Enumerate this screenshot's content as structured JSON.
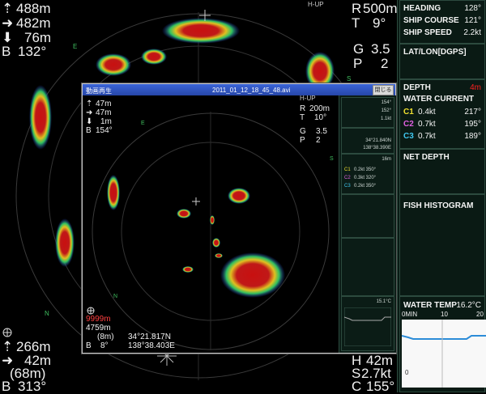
{
  "scope": {
    "top_left": {
      "arrow_up": "488m",
      "arrow_right": "482m",
      "arrow_down": "76m",
      "b": "B",
      "b_val": "132°"
    },
    "top_right": {
      "r": "R",
      "r_val": "500m",
      "t": "T",
      "t_val": "9°",
      "g": "G",
      "g_val": "3.5",
      "p": "P",
      "p_val": "2",
      "mode": "H-UP"
    },
    "bottom_left": {
      "arrow_up": "266m",
      "arrow_right": "42m",
      "paren": "(68m)",
      "b": "B",
      "b_val": "313°"
    },
    "bottom_right": {
      "h": "H",
      "h_val": "42m",
      "s": "S",
      "s_val": "2.7kt",
      "c": "C",
      "c_val": "155°"
    },
    "compass": {
      "e_top": "E",
      "s_right": "S",
      "n_bottom": "N",
      "e_inner": "E",
      "s_inner": "S"
    }
  },
  "sidebar": {
    "heading_label": "HEADING",
    "heading_val": "128°",
    "course_label": "SHIP COURSE",
    "course_val": "121°",
    "speed_label": "SHIP SPEED",
    "speed_val": "2.2kt",
    "latlon_label": "LAT/LON[DGPS]",
    "depth_label": "DEPTH",
    "depth_val": "4m",
    "current_label": "WATER CURRENT",
    "currents": [
      {
        "id": "C1",
        "speed": "0.4kt",
        "dir": "217°",
        "color": "#f0e030"
      },
      {
        "id": "C2",
        "speed": "0.7kt",
        "dir": "195°",
        "color": "#e060e0"
      },
      {
        "id": "C3",
        "speed": "0.7kt",
        "dir": "189°",
        "color": "#40c8f0"
      }
    ],
    "net_depth_label": "NET DEPTH",
    "histogram_label": "FISH HISTOGRAM",
    "water_temp_label": "WATER TEMP",
    "water_temp_val": "16.2°C",
    "temp_axis": {
      "min": "0MIN",
      "mid": "10",
      "max": "20",
      "left_mark": "0"
    }
  },
  "playback": {
    "title_app": "動画再生",
    "title_file": "2011_01_12_18_45_48.avi",
    "close_label": "閉じる",
    "top_left": {
      "a1": "47m",
      "a2": "47m",
      "a3": "1m",
      "b": "B",
      "b_val": "154°"
    },
    "top_right": {
      "mode": "H-UP",
      "r": "R",
      "r_val": "200m",
      "t": "T",
      "t_val": "10°",
      "g": "G",
      "g_val": "3.5",
      "p": "P",
      "p_val": "2"
    },
    "bottom_left": {
      "depth": "9999m",
      "range": "4759m",
      "paren": "(8m)",
      "lat": "34°21.817N",
      "b": "B",
      "b_val": "8°",
      "lon": "138°38.403E"
    },
    "panel": {
      "heading": "154°",
      "course": "152°",
      "speed": "1.1kt",
      "lat": "34°21.840N",
      "lon": "138°38.390E",
      "depth": "16m",
      "currents": [
        {
          "id": "C1",
          "val": "0.2kt 350°"
        },
        {
          "id": "C2",
          "val": "0.3kt 320°"
        },
        {
          "id": "C3",
          "val": "0.2kt 350°"
        }
      ],
      "temp": "15.1°C"
    },
    "compass": {
      "e": "E",
      "s": "S",
      "n": "N"
    }
  }
}
